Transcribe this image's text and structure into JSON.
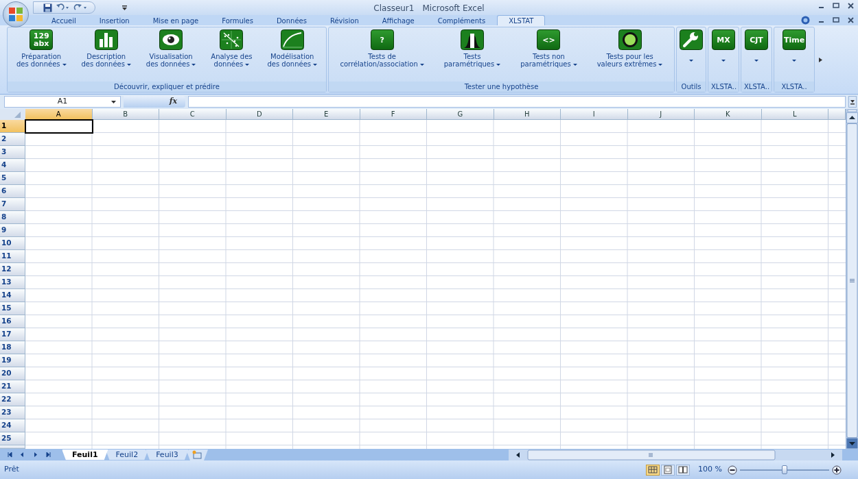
{
  "title_bar": {
    "document": "Classeur1",
    "app": "Microsoft Excel"
  },
  "ribbon_tabs": [
    {
      "label": "Accueil",
      "selected": false
    },
    {
      "label": "Insertion",
      "selected": false
    },
    {
      "label": "Mise en page",
      "selected": false
    },
    {
      "label": "Formules",
      "selected": false
    },
    {
      "label": "Données",
      "selected": false
    },
    {
      "label": "Révision",
      "selected": false
    },
    {
      "label": "Affichage",
      "selected": false
    },
    {
      "label": "Compléments",
      "selected": false
    },
    {
      "label": "XLSTAT",
      "selected": true
    }
  ],
  "ribbon_groups": [
    {
      "label": "Découvrir, expliquer et prédire",
      "buttons": [
        {
          "kind": "split",
          "icon_text": [
            "129",
            "abx"
          ],
          "line1": "Préparation",
          "line2": "des données"
        },
        {
          "kind": "split",
          "line1": "Description",
          "line2": "des données"
        },
        {
          "kind": "split",
          "line1": "Visualisation",
          "line2": "des données"
        },
        {
          "kind": "split",
          "line1": "Analyse des",
          "line2": "données"
        },
        {
          "kind": "split",
          "line1": "Modélisation",
          "line2": "des données"
        }
      ]
    },
    {
      "label": "Tester une hypothèse",
      "buttons": [
        {
          "kind": "split",
          "icon_text": [
            "?"
          ],
          "line1": "Tests de",
          "line2": "corrélation/association"
        },
        {
          "kind": "split",
          "line1": "Tests",
          "line2": "paramétriques"
        },
        {
          "kind": "split",
          "icon_text": [
            "<>"
          ],
          "line1": "Tests non",
          "line2": "paramétriques"
        },
        {
          "kind": "split",
          "line1": "Tests pour les",
          "line2": "valeurs extrêmes"
        }
      ]
    },
    {
      "label": "Outils",
      "buttons": [
        {
          "kind": "menu"
        }
      ]
    },
    {
      "label": "XLSTA..",
      "buttons": [
        {
          "kind": "menu",
          "icon_text": [
            "MX"
          ]
        }
      ]
    },
    {
      "label": "XLSTA..",
      "buttons": [
        {
          "kind": "menu",
          "icon_text": [
            "CJT"
          ]
        }
      ]
    },
    {
      "label": "XLSTA..",
      "buttons": [
        {
          "kind": "menu",
          "icon_text": [
            "Time"
          ]
        }
      ]
    }
  ],
  "formula_bar": {
    "name_box": "A1",
    "function_label": "fx"
  },
  "columns": [
    {
      "label": "A",
      "selected": true
    },
    {
      "label": "B",
      "selected": false
    },
    {
      "label": "C",
      "selected": false
    },
    {
      "label": "D",
      "selected": false
    },
    {
      "label": "E",
      "selected": false
    },
    {
      "label": "F",
      "selected": false
    },
    {
      "label": "G",
      "selected": false
    },
    {
      "label": "H",
      "selected": false
    },
    {
      "label": "I",
      "selected": false
    },
    {
      "label": "J",
      "selected": false
    },
    {
      "label": "K",
      "selected": false
    },
    {
      "label": "L",
      "selected": false
    }
  ],
  "rows": [
    {
      "label": "1",
      "selected": true
    },
    {
      "label": "2",
      "selected": false
    },
    {
      "label": "3",
      "selected": false
    },
    {
      "label": "4",
      "selected": false
    },
    {
      "label": "5",
      "selected": false
    },
    {
      "label": "6",
      "selected": false
    },
    {
      "label": "7",
      "selected": false
    },
    {
      "label": "8",
      "selected": false
    },
    {
      "label": "9",
      "selected": false
    },
    {
      "label": "10",
      "selected": false
    },
    {
      "label": "11",
      "selected": false
    },
    {
      "label": "12",
      "selected": false
    },
    {
      "label": "13",
      "selected": false
    },
    {
      "label": "14",
      "selected": false
    },
    {
      "label": "15",
      "selected": false
    },
    {
      "label": "16",
      "selected": false
    },
    {
      "label": "17",
      "selected": false
    },
    {
      "label": "18",
      "selected": false
    },
    {
      "label": "19",
      "selected": false
    },
    {
      "label": "20",
      "selected": false
    },
    {
      "label": "21",
      "selected": false
    },
    {
      "label": "22",
      "selected": false
    },
    {
      "label": "23",
      "selected": false
    },
    {
      "label": "24",
      "selected": false
    },
    {
      "label": "25",
      "selected": false
    }
  ],
  "sheet_tabs": [
    {
      "label": "Feuil1",
      "selected": true
    },
    {
      "label": "Feuil2",
      "selected": false
    },
    {
      "label": "Feuil3",
      "selected": false
    }
  ],
  "status_bar": {
    "text": "Prêt",
    "views": [
      {
        "selected": true
      },
      {
        "selected": false
      },
      {
        "selected": false
      }
    ],
    "zoom": "100 %",
    "zoom_slider": {
      "level": 0.5
    }
  }
}
